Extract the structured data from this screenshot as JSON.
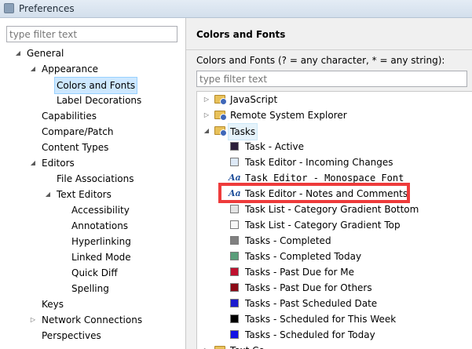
{
  "window": {
    "title": "Preferences"
  },
  "left": {
    "filter_placeholder": "type filter text",
    "tree": [
      {
        "label": "General"
      },
      {
        "label": "Appearance"
      },
      {
        "label": "Colors and Fonts"
      },
      {
        "label": "Label Decorations"
      },
      {
        "label": "Capabilities"
      },
      {
        "label": "Compare/Patch"
      },
      {
        "label": "Content Types"
      },
      {
        "label": "Editors"
      },
      {
        "label": "File Associations"
      },
      {
        "label": "Text Editors"
      },
      {
        "label": "Accessibility"
      },
      {
        "label": "Annotations"
      },
      {
        "label": "Hyperlinking"
      },
      {
        "label": "Linked Mode"
      },
      {
        "label": "Quick Diff"
      },
      {
        "label": "Spelling"
      },
      {
        "label": "Keys"
      },
      {
        "label": "Network Connections"
      },
      {
        "label": "Perspectives"
      }
    ]
  },
  "right": {
    "title": "Colors and Fonts",
    "description": "Colors and Fonts (? = any character, * = any string):",
    "filter_placeholder": "type filter text",
    "items": [
      {
        "label": "JavaScript",
        "kind": "folder"
      },
      {
        "label": "Remote System Explorer",
        "kind": "folder"
      },
      {
        "label": "Tasks",
        "kind": "folder"
      },
      {
        "label": "Task - Active",
        "kind": "color",
        "color": "#2b1f3a"
      },
      {
        "label": "Task Editor - Incoming Changes",
        "kind": "color",
        "color": "#dde9f7"
      },
      {
        "label": "Task Editor - Monospace Font",
        "kind": "font",
        "icon_text": "Aa"
      },
      {
        "label": "Task Editor - Notes and Comments",
        "kind": "font",
        "icon_text": "Aa"
      },
      {
        "label": "Task List - Category Gradient Bottom",
        "kind": "color",
        "color": "#e3e3e3"
      },
      {
        "label": "Task List - Category Gradient Top",
        "kind": "color",
        "color": "#f7f7f7"
      },
      {
        "label": "Tasks - Completed",
        "kind": "color",
        "color": "#808080"
      },
      {
        "label": "Tasks - Completed Today",
        "kind": "color",
        "color": "#5a9e7a"
      },
      {
        "label": "Tasks - Past Due for Me",
        "kind": "color",
        "color": "#c0102e"
      },
      {
        "label": "Tasks - Past Due for Others",
        "kind": "color",
        "color": "#8c0a16"
      },
      {
        "label": "Tasks - Past Scheduled Date",
        "kind": "color",
        "color": "#1c1ccf"
      },
      {
        "label": "Tasks - Scheduled for This Week",
        "kind": "color",
        "color": "#000000"
      },
      {
        "label": "Tasks - Scheduled for Today",
        "kind": "color",
        "color": "#1414e6"
      },
      {
        "label": "Text Co...",
        "kind": "folder"
      }
    ]
  }
}
